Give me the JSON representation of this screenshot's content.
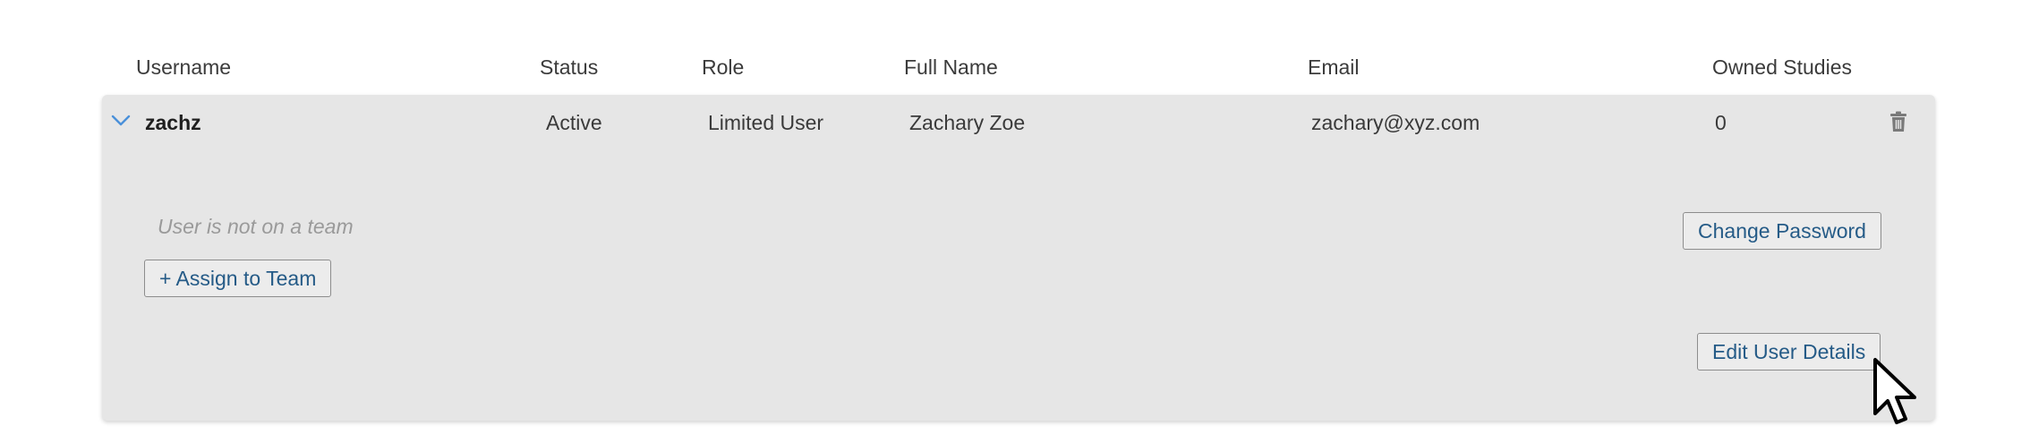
{
  "columns": {
    "username": "Username",
    "status": "Status",
    "role": "Role",
    "full_name": "Full Name",
    "email": "Email",
    "owned_studies": "Owned Studies"
  },
  "user": {
    "username": "zachz",
    "status": "Active",
    "role": "Limited User",
    "full_name": "Zachary Zoe",
    "email": "zachary@xyz.com",
    "owned_studies": "0"
  },
  "details": {
    "team_note": "User is not on a team",
    "assign_button": "+ Assign to Team",
    "change_password_button": "Change Password",
    "edit_details_button": "Edit User Details"
  },
  "icons": {
    "expand": "chevron-down-icon",
    "delete": "trash-icon",
    "pointer": "mouse-cursor-icon"
  },
  "colors": {
    "panel_bg": "#e6e6e6",
    "link_text": "#255b87",
    "chevron": "#4a90d9"
  }
}
